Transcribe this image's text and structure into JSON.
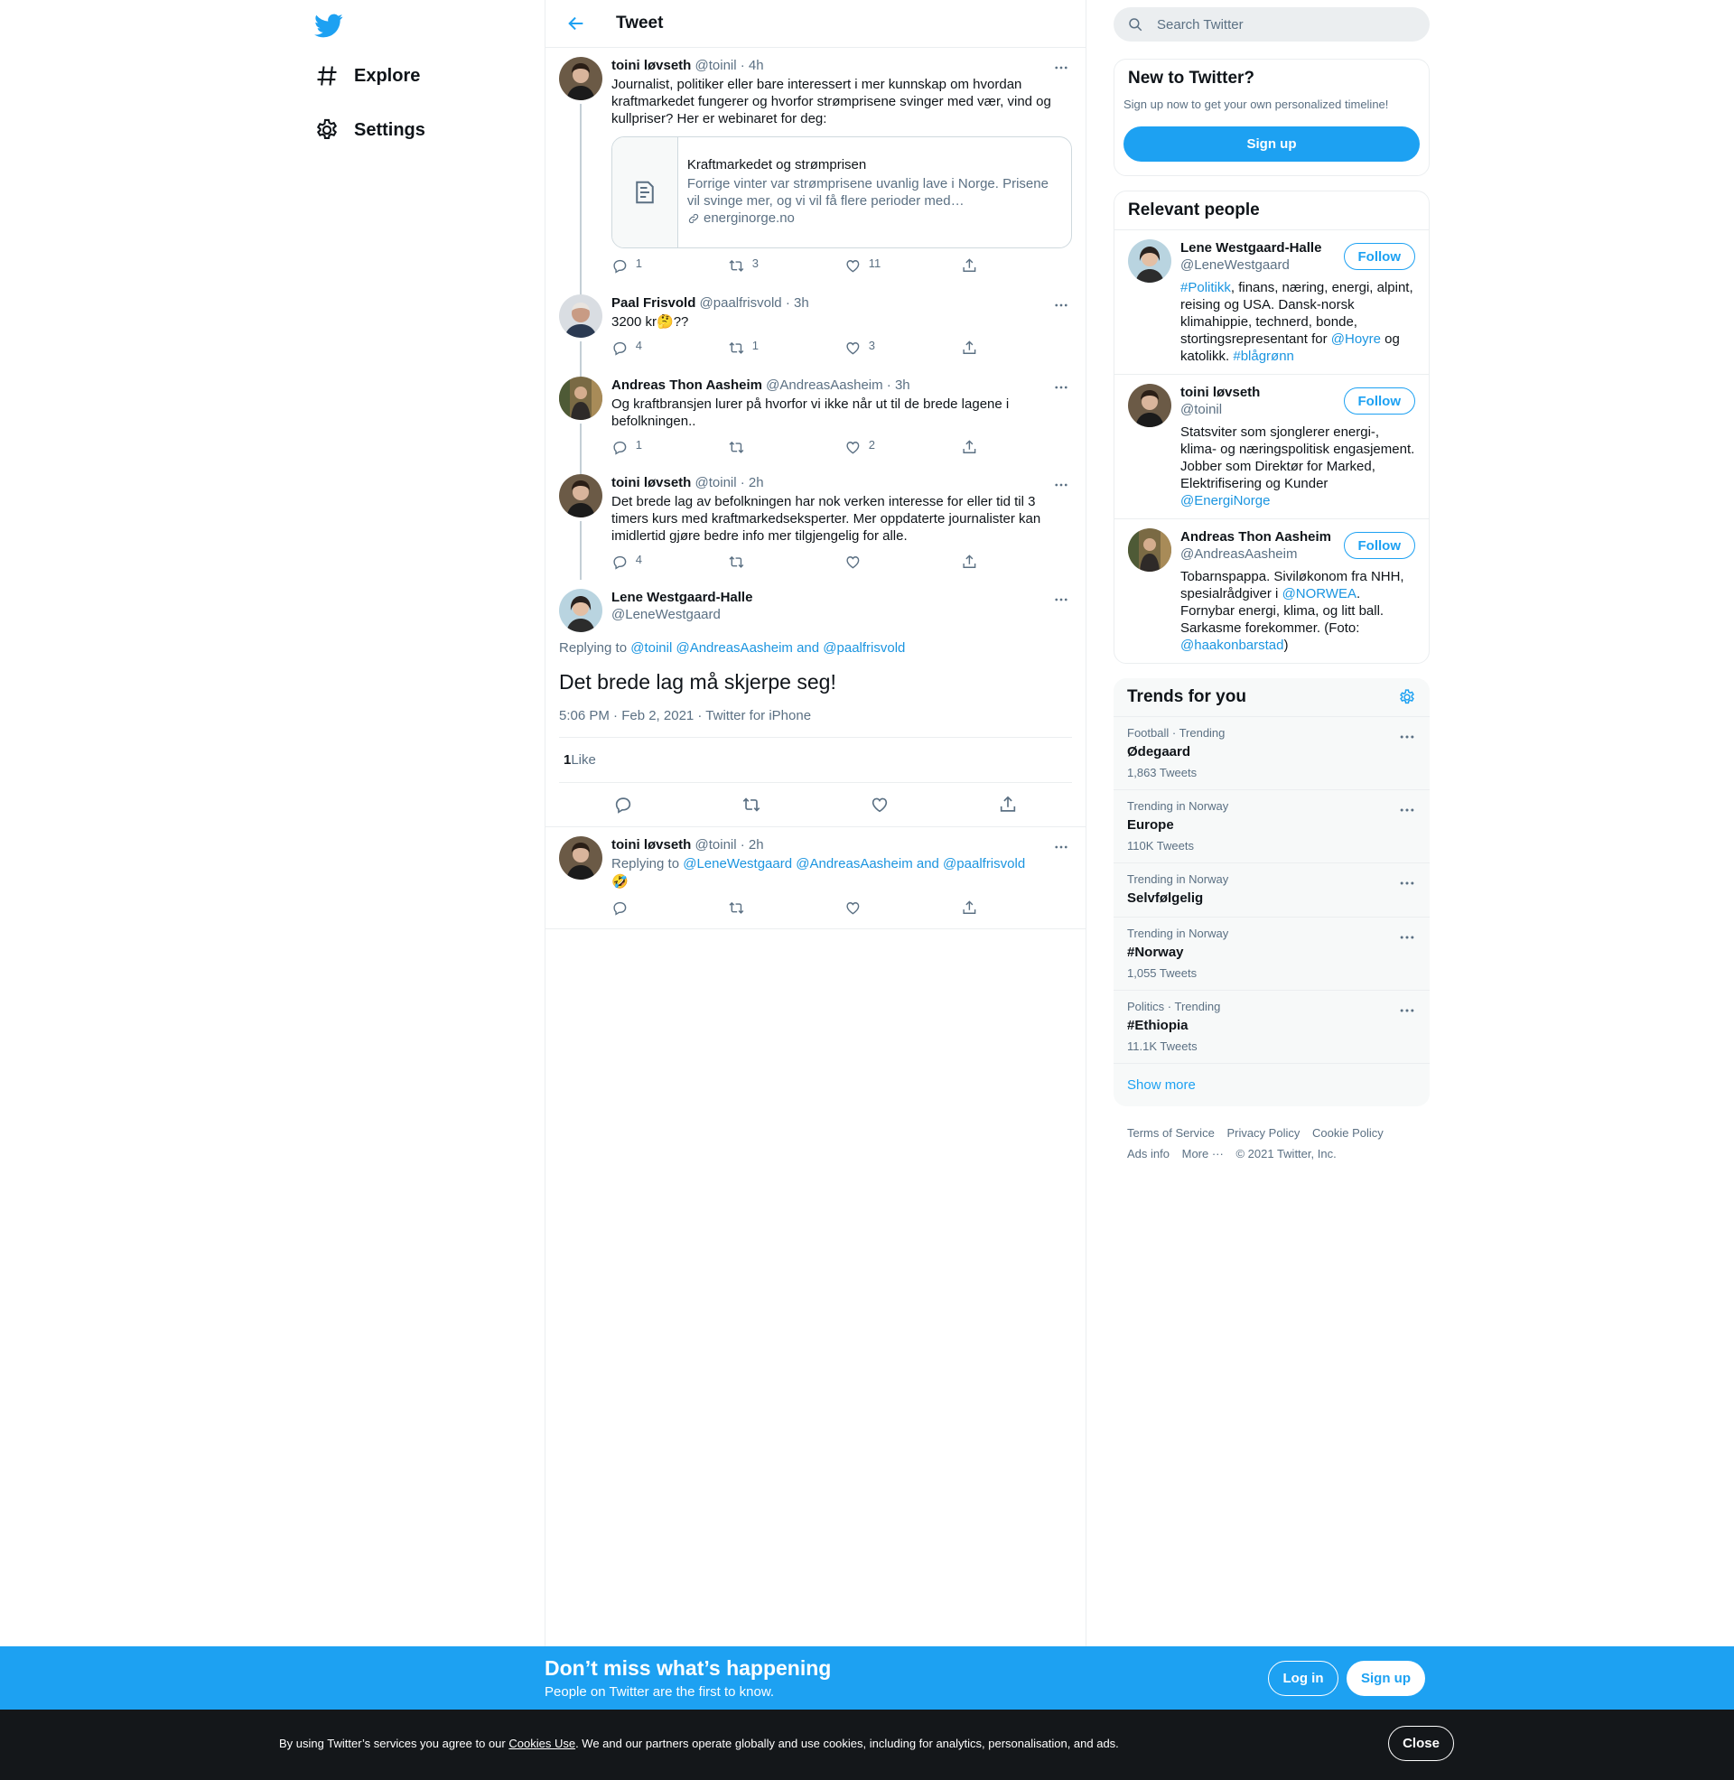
{
  "nav": {
    "explore_label": "Explore",
    "settings_label": "Settings"
  },
  "header": {
    "title": "Tweet"
  },
  "thread": [
    {
      "name": "toini løvseth",
      "handle": "@toinil",
      "time": "· 4h",
      "text": "Journalist, politiker eller bare interessert i mer kunnskap om hvordan kraftmarkedet fungerer og hvorfor strømprisene svinger med vær, vind og kullpriser? Her er webinaret for deg:",
      "card": {
        "title": "Kraftmarkedet og strømprisen",
        "description": "Forrige vinter var strømprisene uvanlig lave i Norge. Prisene vil svinge mer, og vi vil få flere perioder med…",
        "domain": "energinorge.no"
      },
      "replies": "1",
      "retweets": "3",
      "likes": "11"
    },
    {
      "name": "Paal Frisvold",
      "handle": "@paalfrisvold",
      "time": "· 3h",
      "text": "3200 kr🤔??",
      "replies": "4",
      "retweets": "1",
      "likes": "3"
    },
    {
      "name": "Andreas Thon Aasheim",
      "handle": "@AndreasAasheim",
      "time": "· 3h",
      "text": "Og kraftbransjen lurer på hvorfor vi ikke når ut til de brede lagene i befolkningen..",
      "replies": "1",
      "retweets": "",
      "likes": "2"
    },
    {
      "name": "toini løvseth",
      "handle": "@toinil",
      "time": "· 2h",
      "text": "Det brede lag av befolkningen har nok verken interesse for eller tid til 3 timers kurs med kraftmarkedseksperter. Mer oppdaterte journalister kan imidlertid gjøre bedre info mer tilgjengelig for alle.",
      "replies": "4",
      "retweets": "",
      "likes": ""
    }
  ],
  "focal": {
    "name": "Lene Westgaard-Halle",
    "handle": "@LeneWestgaard",
    "replying_prefix": "Replying to ",
    "replying_to": "@toinil @AndreasAasheim and @paalfrisvold",
    "text": "Det brede lag må skjerpe seg!",
    "meta": "5:06 PM · Feb 2, 2021 · Twitter for iPhone",
    "like_count": "1",
    "like_label": " Like"
  },
  "reply": {
    "name": "toini løvseth",
    "handle": "@toinil",
    "time": "· 2h",
    "replying_prefix": "Replying to ",
    "replying_to": "@LeneWestgaard @AndreasAasheim and @paalfrisvold",
    "text": "🤣"
  },
  "search": {
    "placeholder": "Search Twitter"
  },
  "new_to_twitter": {
    "title": "New to Twitter?",
    "subtitle": "Sign up now to get your own personalized timeline!",
    "button": "Sign up"
  },
  "relevant_people": {
    "title": "Relevant people",
    "follow_label": "Follow",
    "people": [
      {
        "name": "Lene Westgaard-Halle",
        "handle": "@LeneWestgaard",
        "bio_parts": [
          "#Politikk",
          ", finans, næring, energi, alpint, reising og USA. Dansk-norsk klimahippie, technerd, bonde, stortingsrepresentant for ",
          "@Hoyre",
          " og katolikk. ",
          "#blågrønn"
        ]
      },
      {
        "name": "toini løvseth",
        "handle": "@toinil",
        "bio_parts": [
          "Statsviter som sjonglerer energi-, klima- og næringspolitisk engasjement. Jobber som Direktør for Marked, Elektrifisering og Kunder ",
          "@EnergiNorge"
        ]
      },
      {
        "name": "Andreas Thon Aasheim",
        "handle": "@AndreasAasheim",
        "bio_parts": [
          "Tobarnspappa. Siviløkonom fra NHH, spesialrådgiver i ",
          "@NORWEA",
          ". Fornybar energi, klima, og litt ball. Sarkasme forekommer. (Foto: ",
          "@haakonbarstad",
          ")"
        ]
      }
    ]
  },
  "trends": {
    "title": "Trends for you",
    "items": [
      {
        "meta": "Football · Trending",
        "name": "Ødegaard",
        "count": "1,863 Tweets"
      },
      {
        "meta": "Trending in Norway",
        "name": "Europe",
        "count": "110K Tweets"
      },
      {
        "meta": "Trending in Norway",
        "name": "Selvfølgelig",
        "count": ""
      },
      {
        "meta": "Trending in Norway",
        "name": "#Norway",
        "count": "1,055 Tweets"
      },
      {
        "meta": "Politics · Trending",
        "name": "#Ethiopia",
        "count": "11.1K Tweets"
      }
    ],
    "show_more": "Show more"
  },
  "footer": {
    "terms": "Terms of Service",
    "privacy": "Privacy Policy",
    "cookie": "Cookie Policy",
    "ads": "Ads info",
    "more": "More ···",
    "copyright": "© 2021 Twitter, Inc."
  },
  "bottom_bar": {
    "title": "Don’t miss what’s happening",
    "subtitle": "People on Twitter are the first to know.",
    "login": "Log in",
    "signup": "Sign up"
  },
  "cookie_bar": {
    "text_before": "By using Twitter’s services you agree to our ",
    "link": "Cookies Use",
    "text_after": ". We and our partners operate globally and use cookies, including for analytics, personalisation, and ads.",
    "close": "Close"
  },
  "colors": {
    "accent": "#1da1f2",
    "link": "#1b95e0",
    "muted": "#5b7083",
    "cookie_bg": "#14171a"
  }
}
